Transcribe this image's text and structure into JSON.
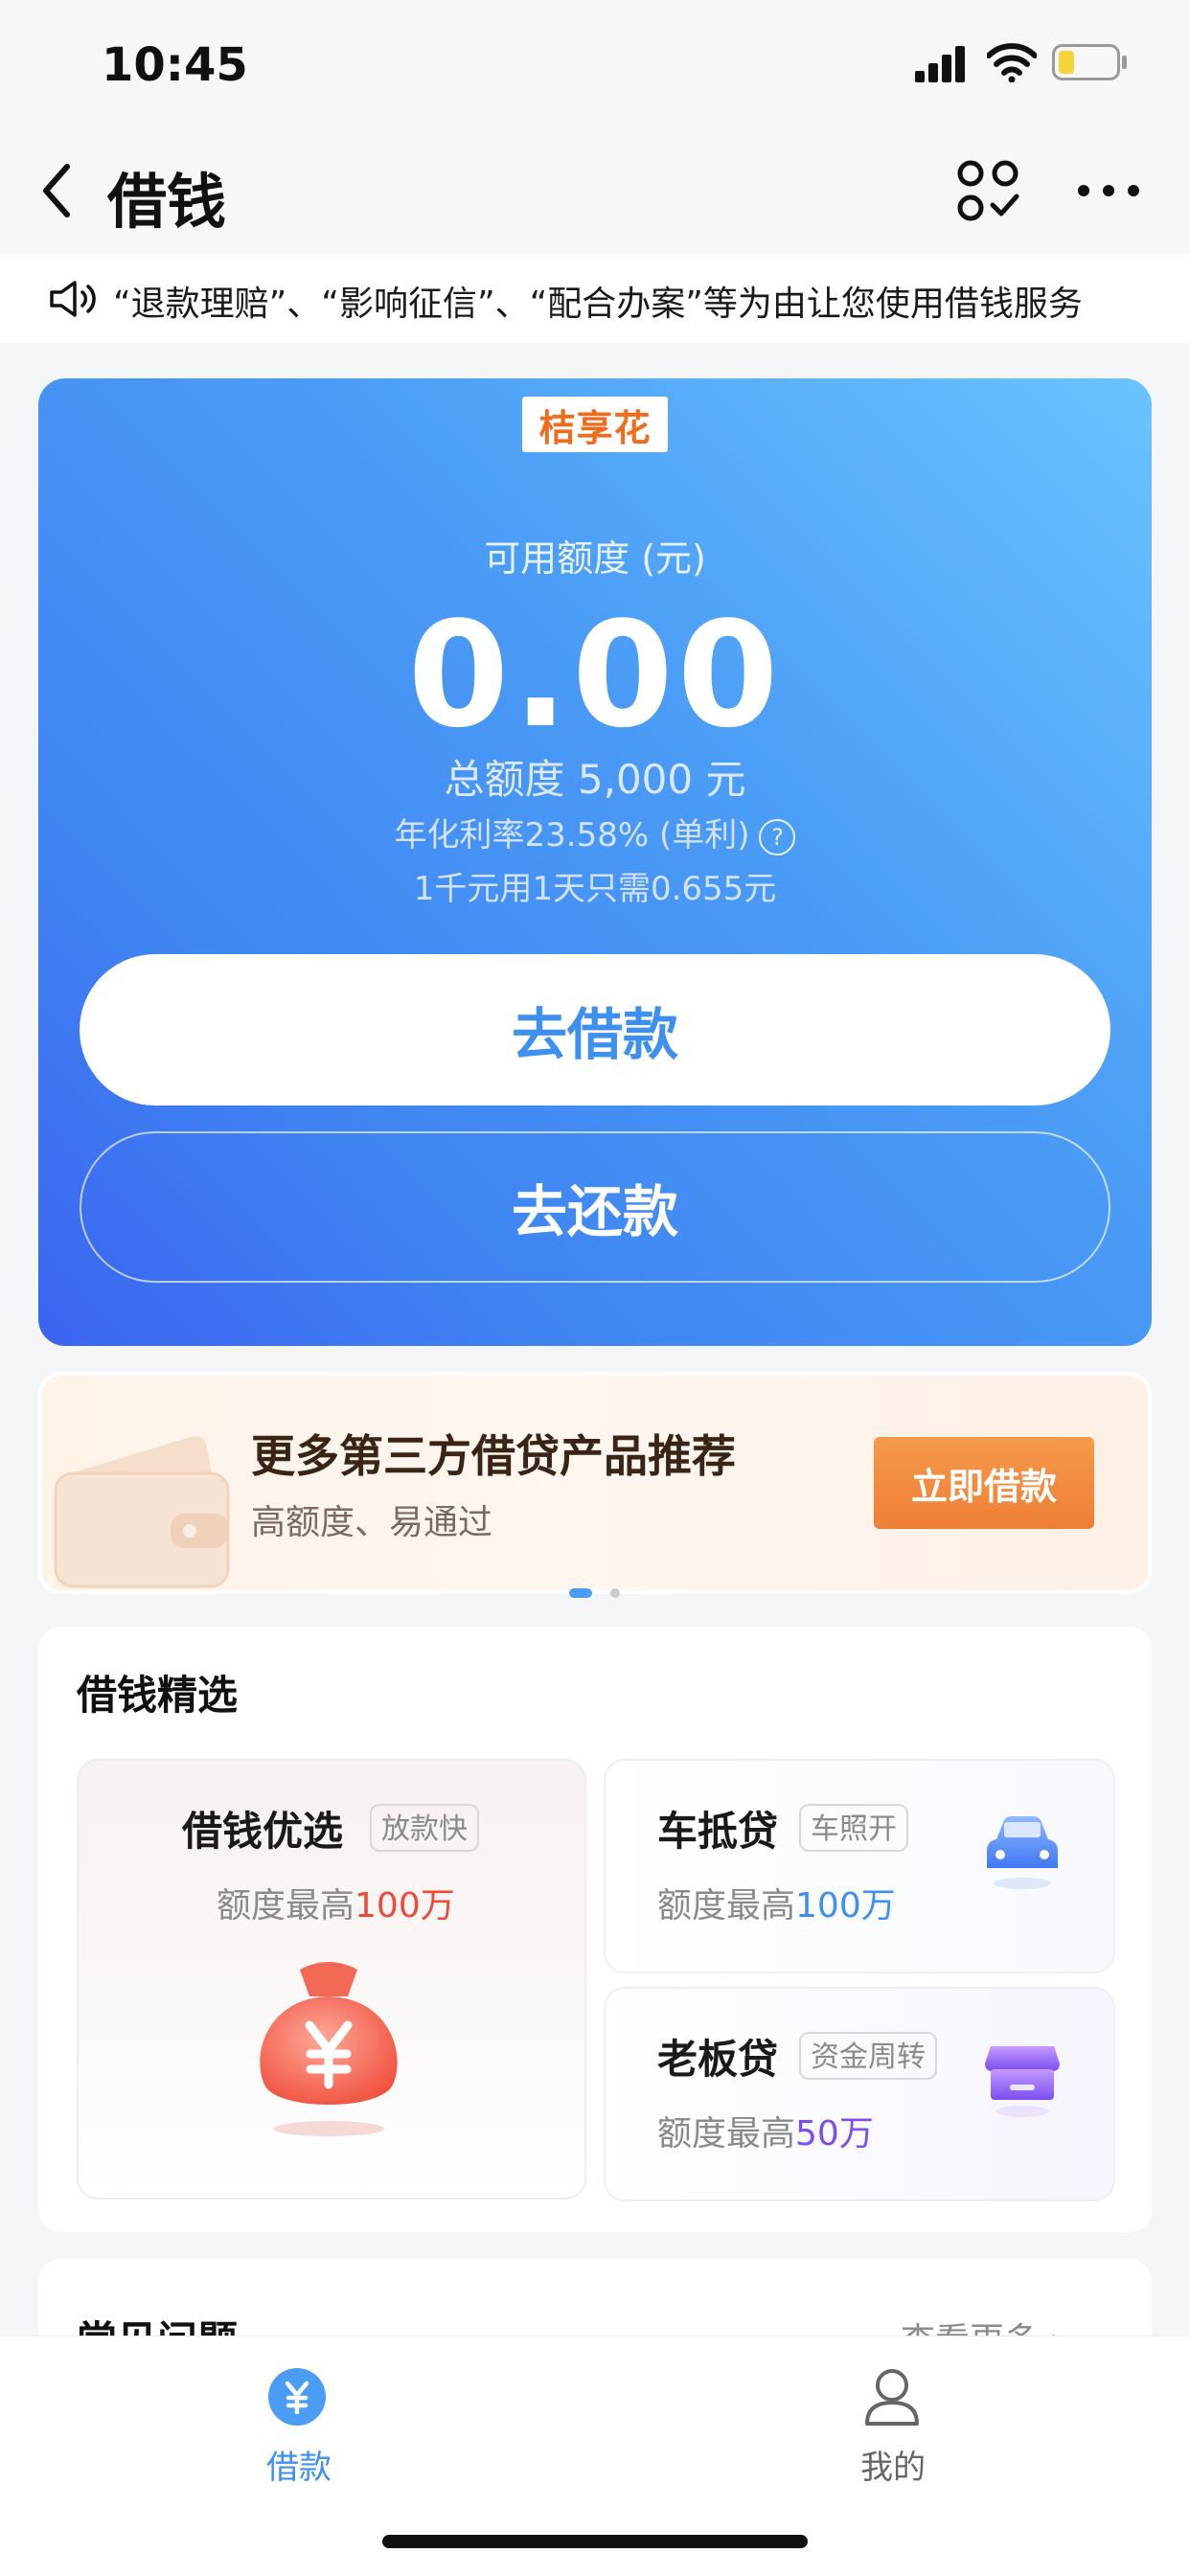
{
  "status_bar": {
    "time": "10:45"
  },
  "nav": {
    "title": "借钱"
  },
  "notice": {
    "text": "“退款理赔”、“影响征信”、“配合办案”等为由让您使用借钱服务"
  },
  "credit_card": {
    "brand": "桔享花",
    "credit_label": "可用额度 (元)",
    "available_amount": "0.00",
    "total_credit": "总额度 5,000 元",
    "rate": "年化利率23.58% (单利)",
    "help_symbol": "?",
    "cost": "1千元用1天只需0.655元",
    "borrow_label": "去借款",
    "repay_label": "去还款"
  },
  "promo": {
    "title": "更多第三方借贷产品推荐",
    "subtitle": "高额度、易通过",
    "button_label": "立即借款"
  },
  "picks": {
    "title": "借钱精选",
    "items": [
      {
        "name": "借钱优选",
        "tag": "放款快",
        "limit_prefix": "额度最高",
        "limit_value": "100万"
      },
      {
        "name": "车抵贷",
        "tag": "车照开",
        "limit_prefix": "额度最高",
        "limit_value": "100万"
      },
      {
        "name": "老板贷",
        "tag": "资金周转",
        "limit_prefix": "额度最高",
        "limit_value": "50万"
      }
    ]
  },
  "faq": {
    "title": "常见问题",
    "more": "查看更多 ›"
  },
  "tabs": [
    {
      "label": "借款",
      "icon": "yuan-icon"
    },
    {
      "label": "我的",
      "icon": "user-icon"
    }
  ],
  "colors": {
    "accent": "#3d8ff0",
    "promo_orange": "#ee7e36",
    "red": "#ee4a3a",
    "purple": "#7a4ef0"
  }
}
